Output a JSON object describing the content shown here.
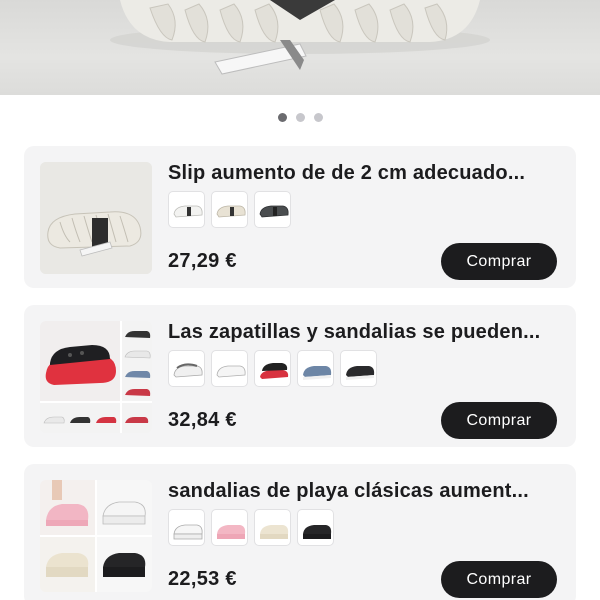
{
  "carousel": {
    "slides": 3,
    "active_index": 0
  },
  "products": [
    {
      "title": "Slip aumento de de 2 cm adecuado...",
      "price": "27,29 €",
      "buy_label": "Comprar",
      "thumbnails": [
        "white-clog",
        "beige-clog",
        "black-clog"
      ]
    },
    {
      "title": "Las zapatillas y sandalias se pueden...",
      "price": "32,84 €",
      "buy_label": "Comprar",
      "thumbnails": [
        "grey-clog",
        "white-clog",
        "red-black-clog",
        "blue-clog",
        "black-clog"
      ]
    },
    {
      "title": "sandalias de playa clásicas aument...",
      "price": "22,53 €",
      "buy_label": "Comprar",
      "thumbnails": [
        "white-clog",
        "pink-clog",
        "beige-clog",
        "black-clog"
      ]
    }
  ],
  "colors": {
    "button": "#1c1c1e",
    "card": "#f4f4f5",
    "dot_active": "#6b6b6f",
    "dot": "#c7c7cc"
  }
}
